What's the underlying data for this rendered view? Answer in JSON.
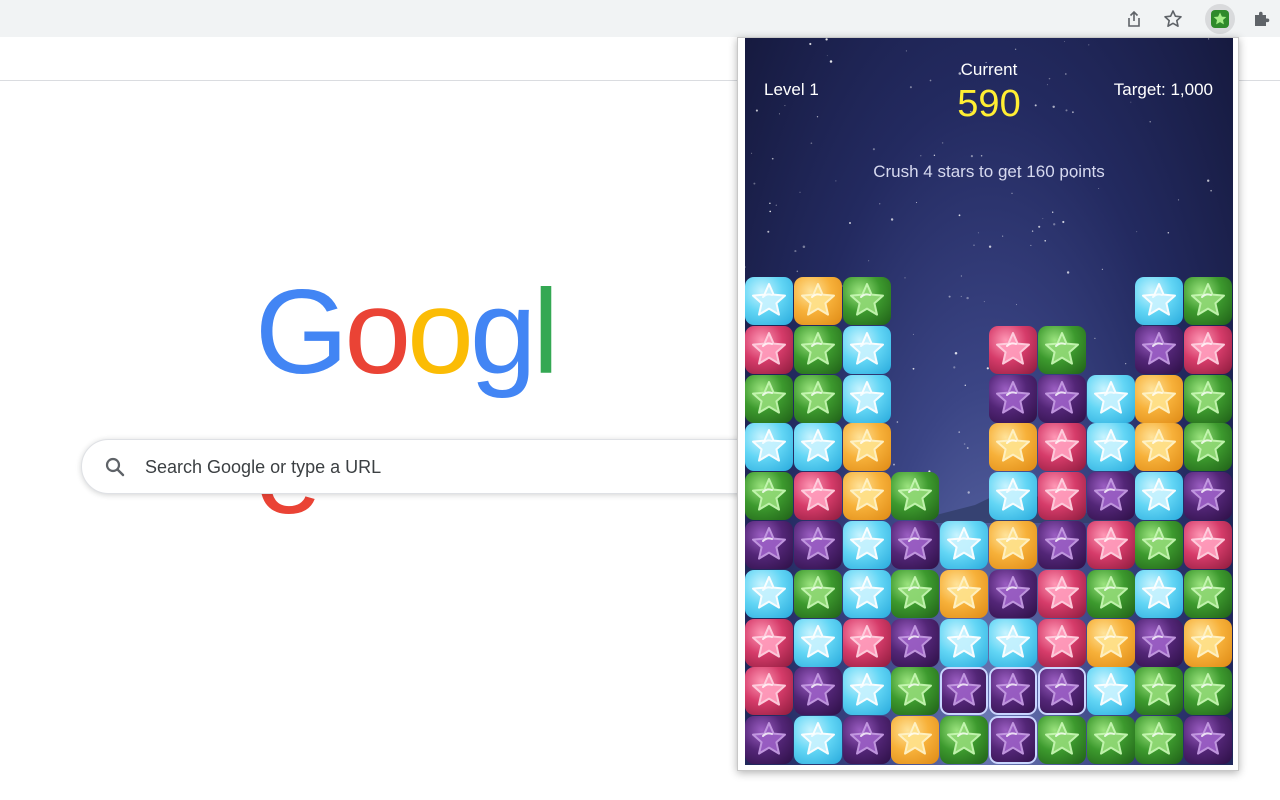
{
  "toolbar": {
    "share_icon": "share-icon",
    "bookmark_icon": "star-outline-icon",
    "extension_icon": "star-game-extension-icon",
    "extensions_icon": "puzzle-icon"
  },
  "google": {
    "logo_letters": [
      "G",
      "o",
      "o",
      "g",
      "l",
      "e"
    ],
    "logo_colors": [
      "#4285F4",
      "#EA4335",
      "#FBBC05",
      "#4285F4",
      "#34A853",
      "#EA4335"
    ],
    "search_placeholder": "Search Google or type a URL"
  },
  "game": {
    "level_label": "Level 1",
    "current_label": "Current",
    "current_score": "590",
    "target_label": "Target: 1,000",
    "hint": "Crush 4 stars to get 160 points",
    "colors": {
      "c": "cyan",
      "o": "orange",
      "g": "green",
      "p": "pink",
      "u": "purple"
    },
    "board_rows": [
      "cog......cg",
      "pgc..pg..up",
      "ggc..uucog",
      "cco..opcog",
      "gpog.cpucu",
      "uucucoupgp",
      "cgcgoupgcg",
      "pcpucppouo",
      "pucguuucgg",
      "ucuoguggcu"
    ],
    "board": [
      [
        "c",
        "o",
        "g",
        ".",
        ".",
        ".",
        ".",
        ".",
        "c",
        "g"
      ],
      [
        "p",
        "g",
        "c",
        ".",
        ".",
        "p",
        "g",
        ".",
        "u",
        "p"
      ],
      [
        "g",
        "g",
        "c",
        ".",
        ".",
        "u",
        "u",
        "c",
        "o",
        "g"
      ],
      [
        "c",
        "c",
        "o",
        ".",
        ".",
        "o",
        "p",
        "c",
        "o",
        "g"
      ],
      [
        "g",
        "p",
        "o",
        "g",
        ".",
        "c",
        "p",
        "u",
        "c",
        "u"
      ],
      [
        "u",
        "u",
        "c",
        "u",
        "c",
        "o",
        "u",
        "p",
        "g",
        "p"
      ],
      [
        "c",
        "g",
        "c",
        "g",
        "o",
        "u",
        "p",
        "g",
        "c",
        "g"
      ],
      [
        "p",
        "c",
        "p",
        "u",
        "c",
        "c",
        "p",
        "o",
        "u",
        "o"
      ],
      [
        "p",
        "u",
        "c",
        "g",
        "u",
        "u",
        "u",
        "c",
        "g",
        "g"
      ],
      [
        "u",
        "c",
        "u",
        "o",
        "g",
        "u",
        "g",
        "g",
        "g",
        "u"
      ]
    ],
    "selected": [
      [
        8,
        4
      ],
      [
        8,
        5
      ],
      [
        8,
        6
      ],
      [
        9,
        5
      ]
    ]
  }
}
